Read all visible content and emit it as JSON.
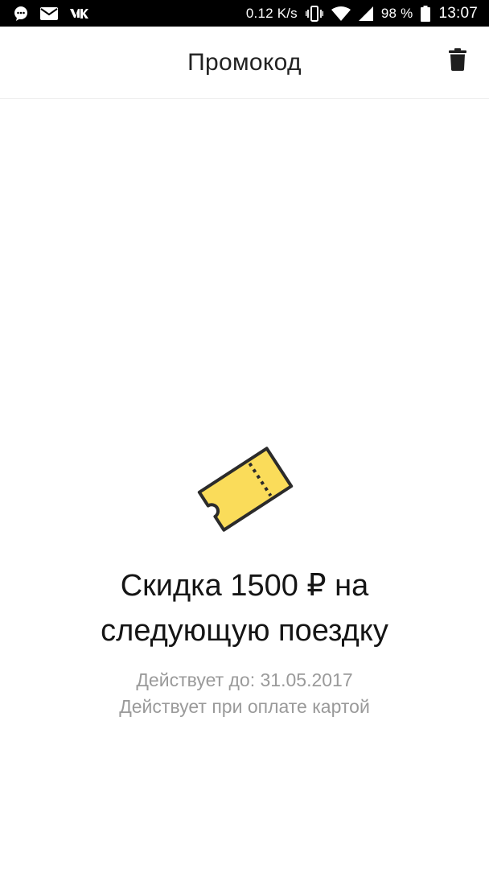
{
  "status_bar": {
    "network_speed": "0.12 K/s",
    "battery_percent": "98 %",
    "battery_level": 0.98,
    "time": "13:07",
    "left_icons": [
      "chat-icon",
      "mail-icon",
      "vk-icon"
    ],
    "right_icons": [
      "vibrate-icon",
      "wifi-icon",
      "signal-icon",
      "battery-icon"
    ]
  },
  "header": {
    "title": "Промокод",
    "action_icon": "trash-icon"
  },
  "promo": {
    "icon": "ticket-icon",
    "title_line1": "Скидка 1500 ₽ на",
    "title_line2": "следующую поездку",
    "valid_until": "Действует до: 31.05.2017",
    "payment_condition": "Действует при оплате картой"
  },
  "colors": {
    "ticket_fill": "#FADC5A",
    "ticket_stroke": "#2B2B2B",
    "text_primary": "#151515",
    "text_secondary": "#9A9A9A"
  }
}
